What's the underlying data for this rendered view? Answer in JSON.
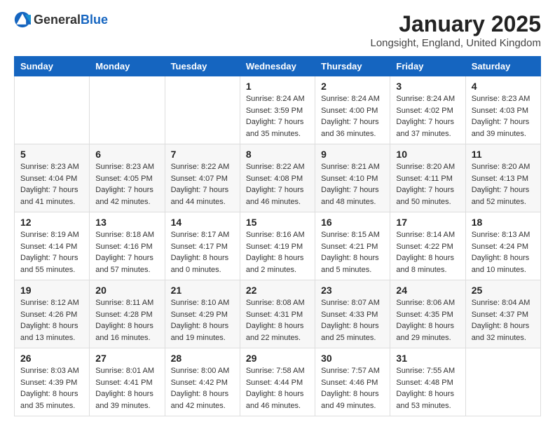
{
  "logo": {
    "general": "General",
    "blue": "Blue"
  },
  "title": "January 2025",
  "location": "Longsight, England, United Kingdom",
  "weekdays": [
    "Sunday",
    "Monday",
    "Tuesday",
    "Wednesday",
    "Thursday",
    "Friday",
    "Saturday"
  ],
  "weeks": [
    [
      {
        "day": "",
        "info": ""
      },
      {
        "day": "",
        "info": ""
      },
      {
        "day": "",
        "info": ""
      },
      {
        "day": "1",
        "info": "Sunrise: 8:24 AM\nSunset: 3:59 PM\nDaylight: 7 hours and 35 minutes."
      },
      {
        "day": "2",
        "info": "Sunrise: 8:24 AM\nSunset: 4:00 PM\nDaylight: 7 hours and 36 minutes."
      },
      {
        "day": "3",
        "info": "Sunrise: 8:24 AM\nSunset: 4:02 PM\nDaylight: 7 hours and 37 minutes."
      },
      {
        "day": "4",
        "info": "Sunrise: 8:23 AM\nSunset: 4:03 PM\nDaylight: 7 hours and 39 minutes."
      }
    ],
    [
      {
        "day": "5",
        "info": "Sunrise: 8:23 AM\nSunset: 4:04 PM\nDaylight: 7 hours and 41 minutes."
      },
      {
        "day": "6",
        "info": "Sunrise: 8:23 AM\nSunset: 4:05 PM\nDaylight: 7 hours and 42 minutes."
      },
      {
        "day": "7",
        "info": "Sunrise: 8:22 AM\nSunset: 4:07 PM\nDaylight: 7 hours and 44 minutes."
      },
      {
        "day": "8",
        "info": "Sunrise: 8:22 AM\nSunset: 4:08 PM\nDaylight: 7 hours and 46 minutes."
      },
      {
        "day": "9",
        "info": "Sunrise: 8:21 AM\nSunset: 4:10 PM\nDaylight: 7 hours and 48 minutes."
      },
      {
        "day": "10",
        "info": "Sunrise: 8:20 AM\nSunset: 4:11 PM\nDaylight: 7 hours and 50 minutes."
      },
      {
        "day": "11",
        "info": "Sunrise: 8:20 AM\nSunset: 4:13 PM\nDaylight: 7 hours and 52 minutes."
      }
    ],
    [
      {
        "day": "12",
        "info": "Sunrise: 8:19 AM\nSunset: 4:14 PM\nDaylight: 7 hours and 55 minutes."
      },
      {
        "day": "13",
        "info": "Sunrise: 8:18 AM\nSunset: 4:16 PM\nDaylight: 7 hours and 57 minutes."
      },
      {
        "day": "14",
        "info": "Sunrise: 8:17 AM\nSunset: 4:17 PM\nDaylight: 8 hours and 0 minutes."
      },
      {
        "day": "15",
        "info": "Sunrise: 8:16 AM\nSunset: 4:19 PM\nDaylight: 8 hours and 2 minutes."
      },
      {
        "day": "16",
        "info": "Sunrise: 8:15 AM\nSunset: 4:21 PM\nDaylight: 8 hours and 5 minutes."
      },
      {
        "day": "17",
        "info": "Sunrise: 8:14 AM\nSunset: 4:22 PM\nDaylight: 8 hours and 8 minutes."
      },
      {
        "day": "18",
        "info": "Sunrise: 8:13 AM\nSunset: 4:24 PM\nDaylight: 8 hours and 10 minutes."
      }
    ],
    [
      {
        "day": "19",
        "info": "Sunrise: 8:12 AM\nSunset: 4:26 PM\nDaylight: 8 hours and 13 minutes."
      },
      {
        "day": "20",
        "info": "Sunrise: 8:11 AM\nSunset: 4:28 PM\nDaylight: 8 hours and 16 minutes."
      },
      {
        "day": "21",
        "info": "Sunrise: 8:10 AM\nSunset: 4:29 PM\nDaylight: 8 hours and 19 minutes."
      },
      {
        "day": "22",
        "info": "Sunrise: 8:08 AM\nSunset: 4:31 PM\nDaylight: 8 hours and 22 minutes."
      },
      {
        "day": "23",
        "info": "Sunrise: 8:07 AM\nSunset: 4:33 PM\nDaylight: 8 hours and 25 minutes."
      },
      {
        "day": "24",
        "info": "Sunrise: 8:06 AM\nSunset: 4:35 PM\nDaylight: 8 hours and 29 minutes."
      },
      {
        "day": "25",
        "info": "Sunrise: 8:04 AM\nSunset: 4:37 PM\nDaylight: 8 hours and 32 minutes."
      }
    ],
    [
      {
        "day": "26",
        "info": "Sunrise: 8:03 AM\nSunset: 4:39 PM\nDaylight: 8 hours and 35 minutes."
      },
      {
        "day": "27",
        "info": "Sunrise: 8:01 AM\nSunset: 4:41 PM\nDaylight: 8 hours and 39 minutes."
      },
      {
        "day": "28",
        "info": "Sunrise: 8:00 AM\nSunset: 4:42 PM\nDaylight: 8 hours and 42 minutes."
      },
      {
        "day": "29",
        "info": "Sunrise: 7:58 AM\nSunset: 4:44 PM\nDaylight: 8 hours and 46 minutes."
      },
      {
        "day": "30",
        "info": "Sunrise: 7:57 AM\nSunset: 4:46 PM\nDaylight: 8 hours and 49 minutes."
      },
      {
        "day": "31",
        "info": "Sunrise: 7:55 AM\nSunset: 4:48 PM\nDaylight: 8 hours and 53 minutes."
      },
      {
        "day": "",
        "info": ""
      }
    ]
  ]
}
